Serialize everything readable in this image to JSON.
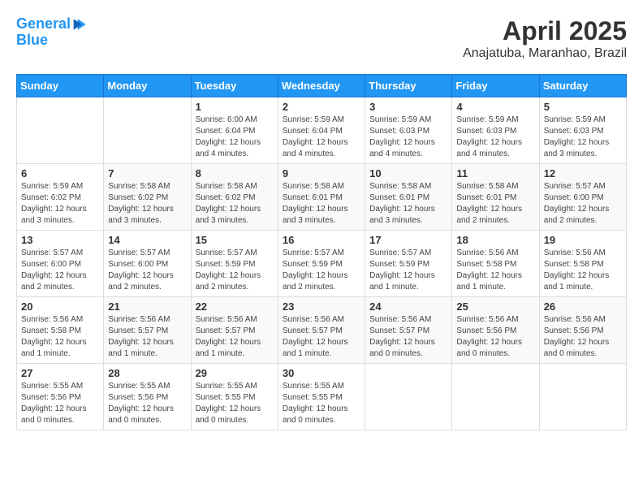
{
  "logo": {
    "line1": "General",
    "line2": "Blue"
  },
  "title": "April 2025",
  "subtitle": "Anajatuba, Maranhao, Brazil",
  "days_of_week": [
    "Sunday",
    "Monday",
    "Tuesday",
    "Wednesday",
    "Thursday",
    "Friday",
    "Saturday"
  ],
  "weeks": [
    [
      {
        "day": "",
        "info": ""
      },
      {
        "day": "",
        "info": ""
      },
      {
        "day": "1",
        "info": "Sunrise: 6:00 AM\nSunset: 6:04 PM\nDaylight: 12 hours\nand 4 minutes."
      },
      {
        "day": "2",
        "info": "Sunrise: 5:59 AM\nSunset: 6:04 PM\nDaylight: 12 hours\nand 4 minutes."
      },
      {
        "day": "3",
        "info": "Sunrise: 5:59 AM\nSunset: 6:03 PM\nDaylight: 12 hours\nand 4 minutes."
      },
      {
        "day": "4",
        "info": "Sunrise: 5:59 AM\nSunset: 6:03 PM\nDaylight: 12 hours\nand 4 minutes."
      },
      {
        "day": "5",
        "info": "Sunrise: 5:59 AM\nSunset: 6:03 PM\nDaylight: 12 hours\nand 3 minutes."
      }
    ],
    [
      {
        "day": "6",
        "info": "Sunrise: 5:59 AM\nSunset: 6:02 PM\nDaylight: 12 hours\nand 3 minutes."
      },
      {
        "day": "7",
        "info": "Sunrise: 5:58 AM\nSunset: 6:02 PM\nDaylight: 12 hours\nand 3 minutes."
      },
      {
        "day": "8",
        "info": "Sunrise: 5:58 AM\nSunset: 6:02 PM\nDaylight: 12 hours\nand 3 minutes."
      },
      {
        "day": "9",
        "info": "Sunrise: 5:58 AM\nSunset: 6:01 PM\nDaylight: 12 hours\nand 3 minutes."
      },
      {
        "day": "10",
        "info": "Sunrise: 5:58 AM\nSunset: 6:01 PM\nDaylight: 12 hours\nand 3 minutes."
      },
      {
        "day": "11",
        "info": "Sunrise: 5:58 AM\nSunset: 6:01 PM\nDaylight: 12 hours\nand 2 minutes."
      },
      {
        "day": "12",
        "info": "Sunrise: 5:57 AM\nSunset: 6:00 PM\nDaylight: 12 hours\nand 2 minutes."
      }
    ],
    [
      {
        "day": "13",
        "info": "Sunrise: 5:57 AM\nSunset: 6:00 PM\nDaylight: 12 hours\nand 2 minutes."
      },
      {
        "day": "14",
        "info": "Sunrise: 5:57 AM\nSunset: 6:00 PM\nDaylight: 12 hours\nand 2 minutes."
      },
      {
        "day": "15",
        "info": "Sunrise: 5:57 AM\nSunset: 5:59 PM\nDaylight: 12 hours\nand 2 minutes."
      },
      {
        "day": "16",
        "info": "Sunrise: 5:57 AM\nSunset: 5:59 PM\nDaylight: 12 hours\nand 2 minutes."
      },
      {
        "day": "17",
        "info": "Sunrise: 5:57 AM\nSunset: 5:59 PM\nDaylight: 12 hours\nand 1 minute."
      },
      {
        "day": "18",
        "info": "Sunrise: 5:56 AM\nSunset: 5:58 PM\nDaylight: 12 hours\nand 1 minute."
      },
      {
        "day": "19",
        "info": "Sunrise: 5:56 AM\nSunset: 5:58 PM\nDaylight: 12 hours\nand 1 minute."
      }
    ],
    [
      {
        "day": "20",
        "info": "Sunrise: 5:56 AM\nSunset: 5:58 PM\nDaylight: 12 hours\nand 1 minute."
      },
      {
        "day": "21",
        "info": "Sunrise: 5:56 AM\nSunset: 5:57 PM\nDaylight: 12 hours\nand 1 minute."
      },
      {
        "day": "22",
        "info": "Sunrise: 5:56 AM\nSunset: 5:57 PM\nDaylight: 12 hours\nand 1 minute."
      },
      {
        "day": "23",
        "info": "Sunrise: 5:56 AM\nSunset: 5:57 PM\nDaylight: 12 hours\nand 1 minute."
      },
      {
        "day": "24",
        "info": "Sunrise: 5:56 AM\nSunset: 5:57 PM\nDaylight: 12 hours\nand 0 minutes."
      },
      {
        "day": "25",
        "info": "Sunrise: 5:56 AM\nSunset: 5:56 PM\nDaylight: 12 hours\nand 0 minutes."
      },
      {
        "day": "26",
        "info": "Sunrise: 5:56 AM\nSunset: 5:56 PM\nDaylight: 12 hours\nand 0 minutes."
      }
    ],
    [
      {
        "day": "27",
        "info": "Sunrise: 5:55 AM\nSunset: 5:56 PM\nDaylight: 12 hours\nand 0 minutes."
      },
      {
        "day": "28",
        "info": "Sunrise: 5:55 AM\nSunset: 5:56 PM\nDaylight: 12 hours\nand 0 minutes."
      },
      {
        "day": "29",
        "info": "Sunrise: 5:55 AM\nSunset: 5:55 PM\nDaylight: 12 hours\nand 0 minutes."
      },
      {
        "day": "30",
        "info": "Sunrise: 5:55 AM\nSunset: 5:55 PM\nDaylight: 12 hours\nand 0 minutes."
      },
      {
        "day": "",
        "info": ""
      },
      {
        "day": "",
        "info": ""
      },
      {
        "day": "",
        "info": ""
      }
    ]
  ]
}
